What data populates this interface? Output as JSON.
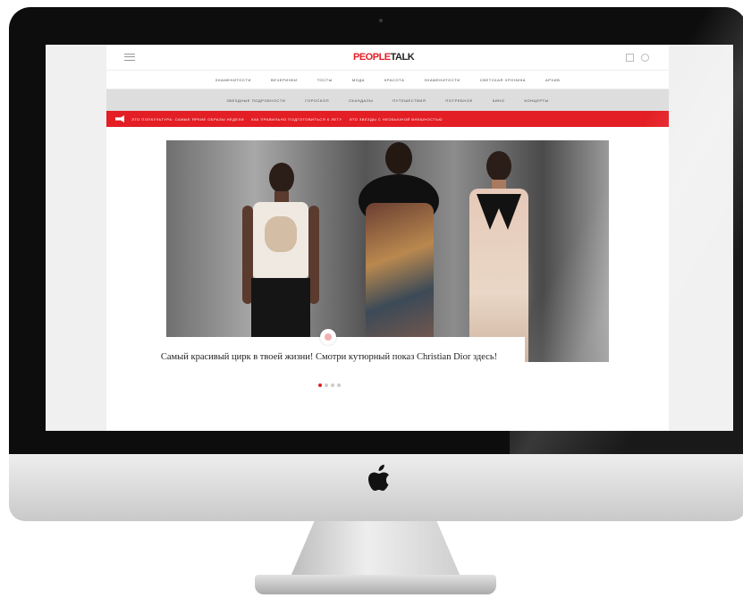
{
  "site": {
    "logo_part1": "PEOPLE",
    "logo_part2": "TALK"
  },
  "header": {
    "icons": [
      "menu-icon",
      "cart-icon",
      "search-icon"
    ]
  },
  "nav_primary": [
    "ЗНАМЕНИТОСТИ",
    "ВЕЧЕРИНКИ",
    "ТОСТЫ",
    "МОДА",
    "КРАСОТА",
    "ЗНАМЕНИТОСТИ",
    "СВЕТСКАЯ ХРОНИКА",
    "АРХИВ"
  ],
  "nav_secondary": [
    "ЗВЕЗДНЫЕ ПОДРОБНОСТИ",
    "ГОРОСКОП",
    "СКАНДАЛЫ",
    "ПУТЕШЕСТВИЯ",
    "ПОТРЕБНОЕ",
    "КИНО",
    "КОНЦЕРТЫ"
  ],
  "ticker": {
    "items": [
      "ЭТО ПОПКУЛЬТУРА: САМЫЕ ЯРКИЕ ОБРАЗЫ НЕДЕЛИ",
      "КАК ПРАВИЛЬНО ПОДГОТОВИТЬСЯ К ЛЕТУ",
      "ЭТО ЗВЕЗДЫ С НЕОБЫЧНОЙ ВНЕШНОСТЬЮ"
    ]
  },
  "hero": {
    "caption": "Самый красивый цирк в твоей жизни! Смотри кутюрный показ Christian Dior здесь!",
    "slides": 4,
    "active_slide": 1
  },
  "colors": {
    "accent": "#e31e24",
    "bezel": "#0d0d0d",
    "nav_bg": "#dddddd"
  }
}
